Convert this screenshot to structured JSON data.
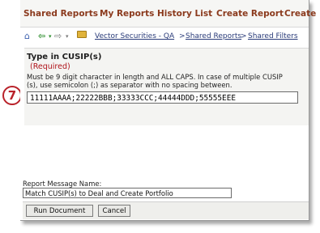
{
  "callout": {
    "number": "7"
  },
  "tabs": [
    "Shared Reports",
    "My Reports",
    "History List",
    "Create Report",
    "Create"
  ],
  "toolbar": {
    "breadcrumb": [
      {
        "label": "Vector Securities - QA",
        "sep": ">"
      },
      {
        "label": "Shared Reports",
        "sep": ">"
      },
      {
        "label": "Shared Filters",
        "sep": ""
      }
    ]
  },
  "prompt": {
    "title": "Type in CUSIP(s)",
    "required": "(Required)",
    "description": "Must be 9 digit character in length and ALL CAPS. In case of multiple CUSIP (s), use semicolon (;) as separator with no spacing between.",
    "value": "11111AAAA;22222BBB;33333CCC;44444DDD;55555EEE"
  },
  "message": {
    "label": "Report Message Name:",
    "value": "Match CUSIP(s) to Deal and Create Portfolio"
  },
  "buttons": {
    "run": "Run Document",
    "cancel": "Cancel"
  },
  "colors": {
    "tab_text": "#8b3a1d",
    "callout": "#b9222a",
    "required": "#b0141b",
    "link": "#283a78"
  }
}
